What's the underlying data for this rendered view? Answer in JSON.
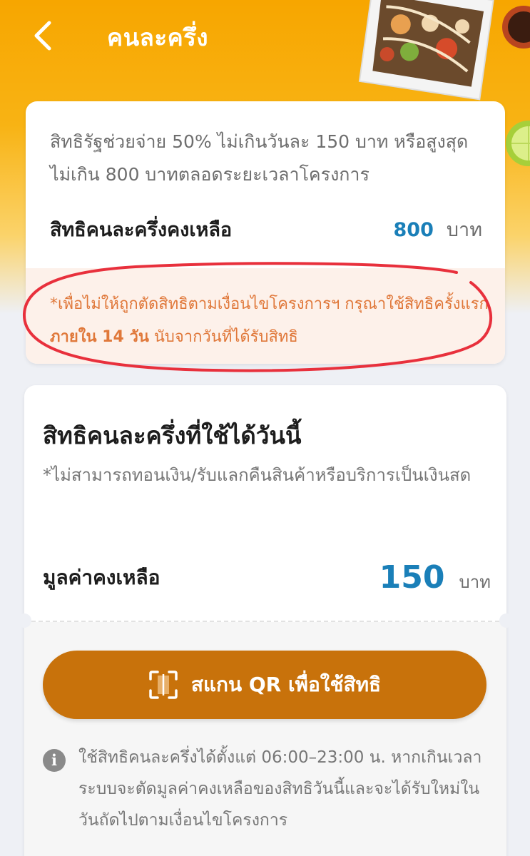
{
  "header": {
    "title": "คนละครึ่ง",
    "back_icon": "chevron-left-icon"
  },
  "summary_card": {
    "description": "สิทธิรัฐช่วยจ่าย 50% ไม่เกินวันละ 150 บาท หรือสูงสุดไม่เกิน 800 บาทตลอดระยะเวลาโครงการ",
    "remaining_label": "สิทธิคนละครึ่งคงเหลือ",
    "remaining_value": "800",
    "remaining_unit": "บาท",
    "warning_prefix": "*เพื่อไม่ให้ถูกตัดสิทธิตามเงื่อนไขโครงการฯ กรุณาใช้สิทธิครั้งแรก ",
    "warning_bold": "ภายใน 14 วัน",
    "warning_suffix": " นับจากวันที่ได้รับสิทธิ"
  },
  "today_card": {
    "title": "สิทธิคนละครึ่งที่ใช้ได้วันนี้",
    "note": "*ไม่สามารถทอนเงิน/รับแลกคืนสินค้าหรือบริการเป็นเงินสด",
    "value_label": "มูลค่าคงเหลือ",
    "value_amount": "150",
    "value_unit": "บาท",
    "scan_button_label": "สแกน QR เพื่อใช้สิทธิ",
    "scan_icon": "qr-scan-icon",
    "info_icon": "info-icon",
    "info_text": "ใช้สิทธิคนละครึ่งได้ตั้งแต่ 06:00–23:00 น. หากเกินเวลา ระบบจะตัดมูลค่าคงเหลือของสิทธิวันนี้และจะได้รับใหม่ในวันถัดไปตามเงื่อนไขโครงการ"
  },
  "colors": {
    "header": "#f7a600",
    "accent_blue": "#1a7fb8",
    "button": "#c8720b",
    "warning_text": "#e0783a",
    "annotation": "#e8303c"
  }
}
